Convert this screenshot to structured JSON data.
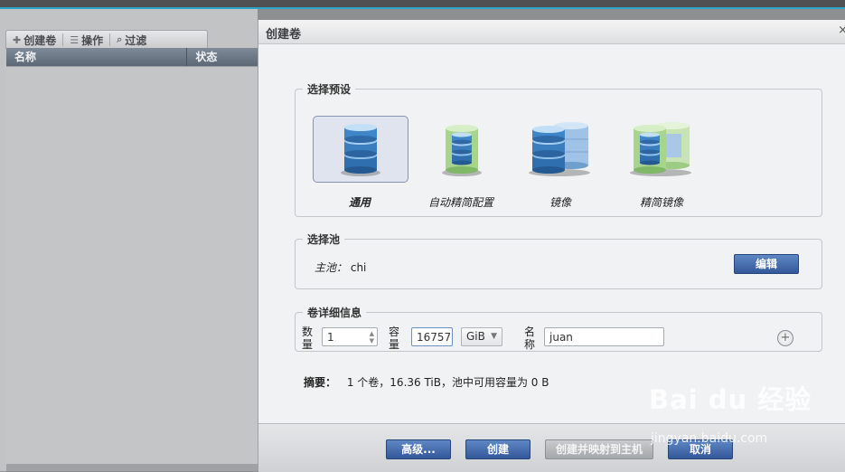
{
  "left_panel": {
    "toolbar": [
      {
        "icon": "plus-icon",
        "label": "创建卷"
      },
      {
        "icon": "list-icon",
        "label": "操作"
      },
      {
        "icon": "search-icon",
        "label": "过滤"
      }
    ],
    "columns": [
      "名称",
      "状态"
    ]
  },
  "dialog": {
    "title": "创建卷",
    "close": "×",
    "preset_group": {
      "legend": "选择预设",
      "presets": [
        {
          "label": "通用",
          "icon": "single-blue-database-icon",
          "selected": true
        },
        {
          "label": "自动精简配置",
          "icon": "green-thin-database-icon",
          "selected": false
        },
        {
          "label": "镜像",
          "icon": "mirrored-blue-database-icon",
          "selected": false
        },
        {
          "label": "精简镜像",
          "icon": "mirrored-green-database-icon",
          "selected": false
        }
      ]
    },
    "pool_group": {
      "legend": "选择池",
      "pool_key": "主池：",
      "pool_value": "chi",
      "edit_label": "编辑"
    },
    "details_group": {
      "legend": "卷详细信息",
      "quantity_label": "数量",
      "quantity_value": "1",
      "capacity_label": "容量",
      "capacity_value": "16757",
      "unit": "GiB",
      "name_label": "名称",
      "name_value": "juan"
    },
    "summary": {
      "label": "摘要：",
      "text": "1 个卷，16.36 TiB，池中可用容量为 0 B"
    },
    "buttons": {
      "advanced": "高级...",
      "create": "创建",
      "create_map": "创建并映射到主机",
      "cancel": "取消"
    }
  },
  "watermark": {
    "brand": "Bai du 经验",
    "url": "jingyan.baidu.com"
  },
  "colors": {
    "accent": "#2aa6c8",
    "button_blue": "#3f65a8",
    "selected_preset": "#dfe4ef"
  }
}
